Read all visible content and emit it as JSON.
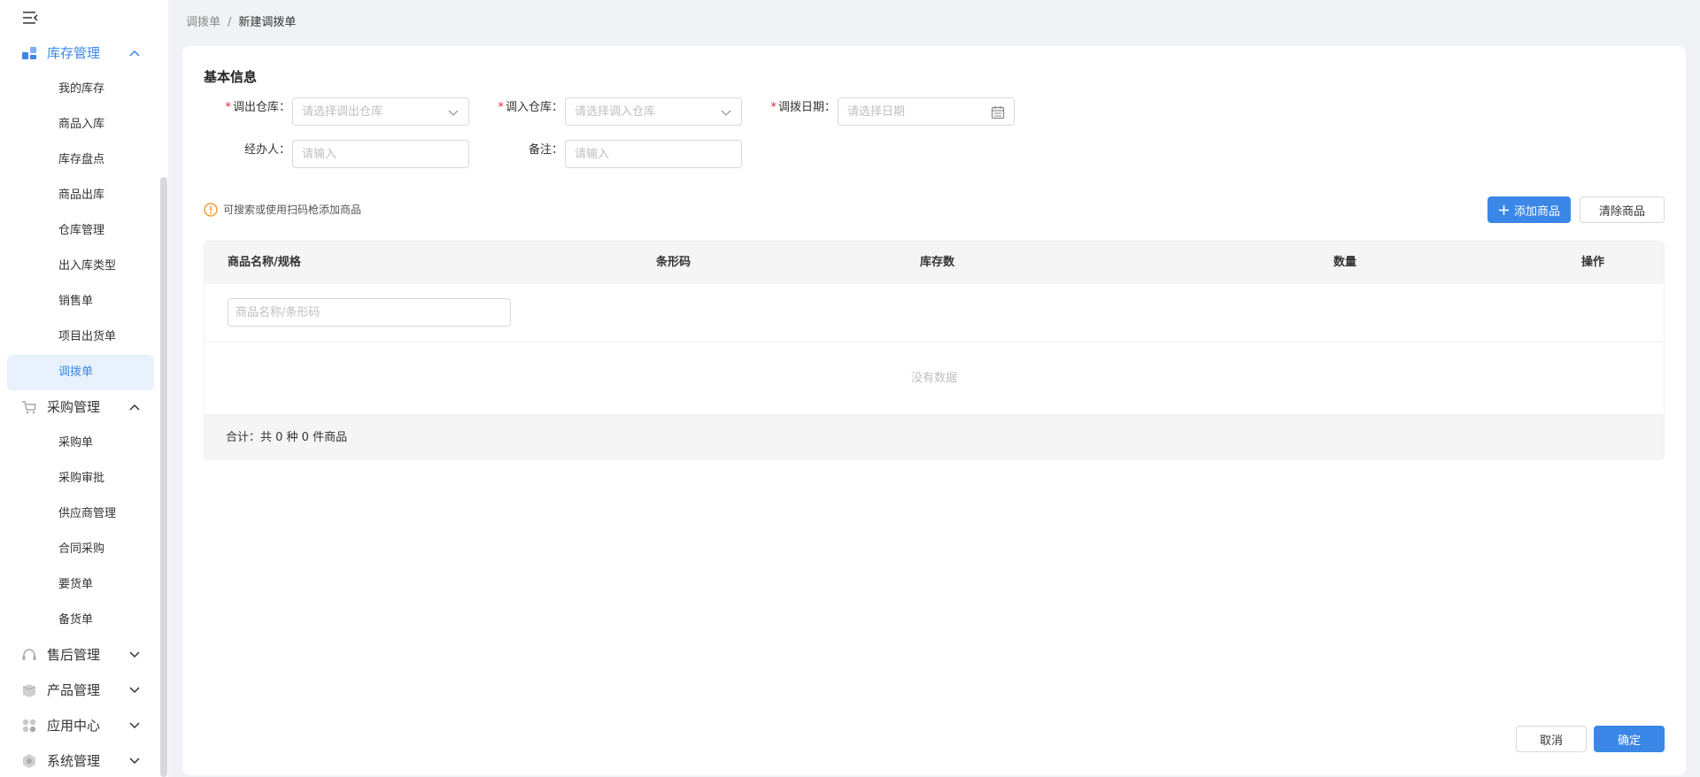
{
  "sidebar": {
    "groups": {
      "inventory": {
        "label": "库存管理",
        "icon": "inventory-icon",
        "expanded": true
      },
      "purchase": {
        "label": "采购管理",
        "icon": "cart-icon",
        "expanded": true
      },
      "aftersale": {
        "label": "售后管理",
        "icon": "headset-icon",
        "expanded": false
      },
      "product": {
        "label": "产品管理",
        "icon": "box-icon",
        "expanded": false
      },
      "apps": {
        "label": "应用中心",
        "icon": "apps-icon",
        "expanded": false
      },
      "system": {
        "label": "系统管理",
        "icon": "settings-icon",
        "expanded": false
      }
    },
    "inventory_items": [
      "我的库存",
      "商品入库",
      "库存盘点",
      "商品出库",
      "仓库管理",
      "出入库类型",
      "销售单",
      "项目出货单",
      "调拨单"
    ],
    "purchase_items": [
      "采购单",
      "采购审批",
      "供应商管理",
      "合同采购",
      "要货单",
      "备货单"
    ],
    "active_item": "调拨单"
  },
  "breadcrumb": {
    "parent": "调拨单",
    "separator": "/",
    "current": "新建调拨单"
  },
  "form": {
    "section_title": "基本信息",
    "out_warehouse": {
      "label": "调出仓库：",
      "placeholder": "请选择调出仓库",
      "required": true
    },
    "in_warehouse": {
      "label": "调入仓库：",
      "placeholder": "请选择调入仓库",
      "required": true
    },
    "transfer_date": {
      "label": "调拨日期：",
      "placeholder": "请选择日期",
      "required": true
    },
    "handler": {
      "label": "经办人：",
      "placeholder": "请输入"
    },
    "remark": {
      "label": "备注：",
      "placeholder": "请输入"
    }
  },
  "goods": {
    "tip": "可搜索或使用扫码枪添加商品",
    "add_button": "添加商品",
    "clear_button": "清除商品",
    "columns": [
      "商品名称/规格",
      "条形码",
      "库存数",
      "数量",
      "操作"
    ],
    "search_placeholder": "商品名称/条形码",
    "empty_text": "没有数据",
    "summary": "合计：共 0 种 0 件商品"
  },
  "footer": {
    "cancel": "取消",
    "confirm": "确定"
  },
  "colors": {
    "accent": "#3a87e8",
    "required": "#f5222d",
    "warning": "#fa8c16"
  }
}
